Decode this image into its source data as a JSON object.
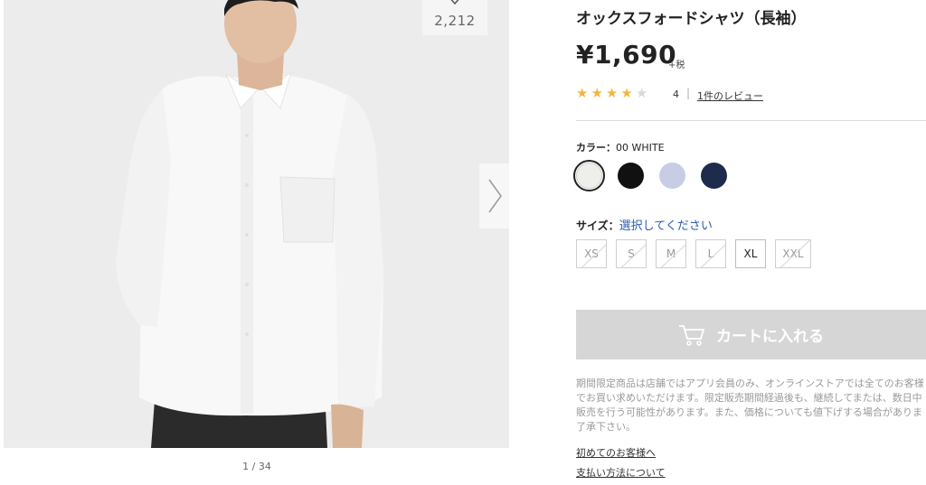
{
  "gallery": {
    "favorite_count": "2,212",
    "counter": "1 / 34"
  },
  "product": {
    "title": "オックスフォードシャツ（長袖）",
    "price": "¥1,690",
    "tax_suffix": "+税",
    "rating_stars": 4,
    "rating_max": 5,
    "rating_value": "4",
    "separator": "|",
    "review_link": "1件のレビュー"
  },
  "color": {
    "label": "カラー：",
    "selected": "00 WHITE",
    "options": [
      {
        "hex": "#eeeeea"
      },
      {
        "hex": "#111111"
      },
      {
        "hex": "#c7cde4"
      },
      {
        "hex": "#1e2b4c"
      }
    ]
  },
  "size": {
    "label": "サイズ：",
    "prompt": "選択してください",
    "options": [
      {
        "label": "XS",
        "available": false
      },
      {
        "label": "S",
        "available": false
      },
      {
        "label": "M",
        "available": false
      },
      {
        "label": "L",
        "available": false
      },
      {
        "label": "XL",
        "available": true
      },
      {
        "label": "XXL",
        "available": false
      }
    ]
  },
  "cart": {
    "label": "カートに入れる"
  },
  "notice": {
    "lines": [
      "期間限定商品は店舗ではアプリ会員のみ、オンラインストアでは全てのお客様",
      "でお買い求めいただけます。限定販売期間経過後も、継続してまたは、数日中",
      "販売を行う可能性があります。また、価格についても値下げする場合がありま",
      "了承下さい。"
    ]
  },
  "links": {
    "first_time": "初めてのお客様へ",
    "payment": "支払い方法について"
  },
  "colors": {
    "star_on": "#f4b63f",
    "star_off": "#d8d8d8",
    "select_prompt": "#2a5bb0",
    "cart_disabled": "#d6d6d6"
  }
}
